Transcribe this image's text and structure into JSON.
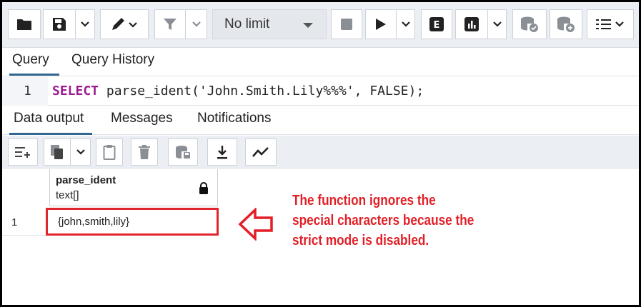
{
  "toolbar": {
    "limit_label": "No limit",
    "buttons": [
      {
        "icon": "folder-icon"
      },
      {
        "icon": "save-icon"
      },
      {
        "icon": "edit-pen-icon"
      },
      {
        "icon": "filter-icon"
      },
      {
        "icon": "stop-icon"
      },
      {
        "icon": "execute-icon"
      },
      {
        "icon": "explain-icon",
        "label": "E"
      },
      {
        "icon": "explain-analyze-icon"
      },
      {
        "icon": "commit-icon"
      },
      {
        "icon": "rollback-icon"
      },
      {
        "icon": "macros-icon"
      }
    ]
  },
  "query_tabs": [
    {
      "label": "Query",
      "active": true
    },
    {
      "label": "Query History",
      "active": false
    }
  ],
  "editor": {
    "line_number": "1",
    "keyword": "SELECT",
    "code_rest": " parse_ident('John.Smith.Lily%%%', FALSE);"
  },
  "output_tabs": [
    {
      "label": "Data output",
      "active": true
    },
    {
      "label": "Messages",
      "active": false
    },
    {
      "label": "Notifications",
      "active": false
    }
  ],
  "grid": {
    "column": {
      "name": "parse_ident",
      "type": "text[]"
    },
    "rows": [
      {
        "num": "1",
        "value": "{john,smith,lily}"
      }
    ]
  },
  "annotation": {
    "text": "The function ignores the special characters because the strict mode is disabled.",
    "color": "#e21f26"
  },
  "colors": {
    "accent": "#326690",
    "keyword": "#9b1c8f",
    "highlight": "#e0262b"
  }
}
